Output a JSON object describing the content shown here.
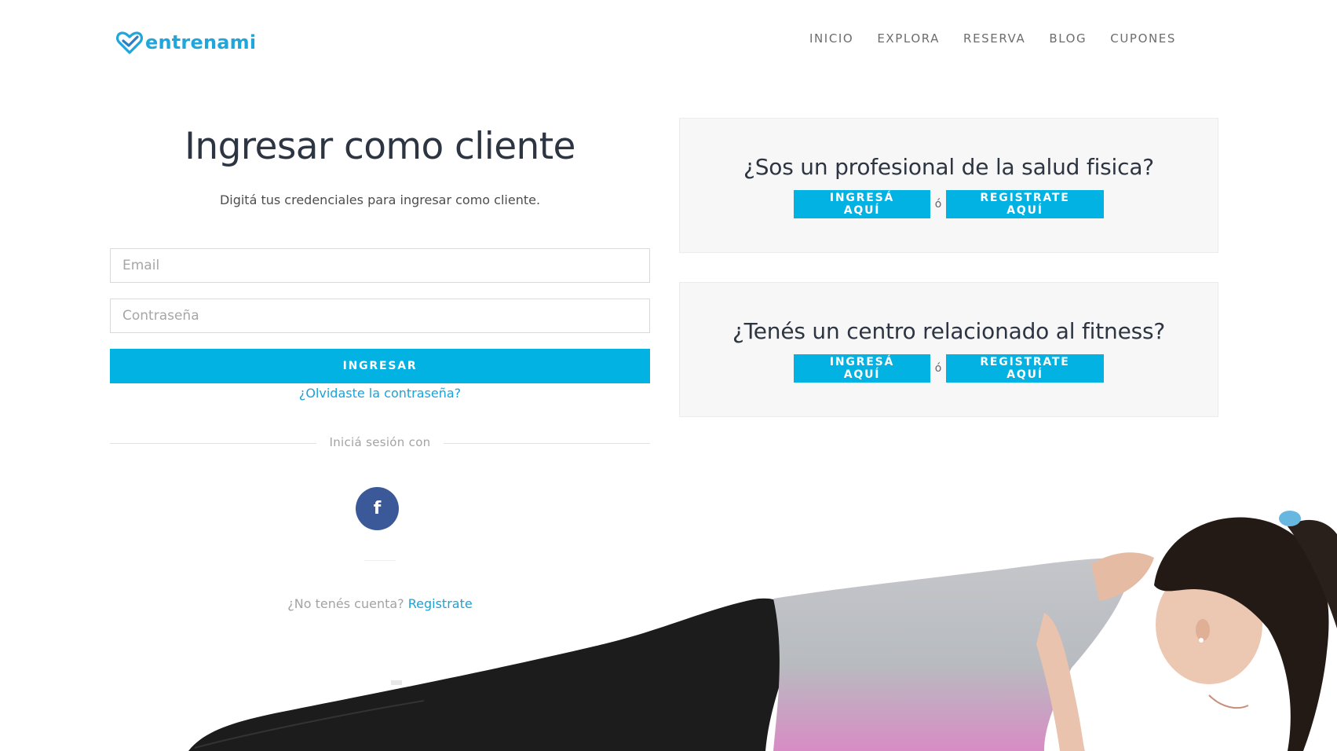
{
  "header": {
    "logo_text": "entrenami",
    "nav": [
      "INICIO",
      "EXPLORA",
      "RESERVA",
      "BLOG",
      "CUPONES"
    ]
  },
  "login": {
    "title": "Ingresar como cliente",
    "subtitle": "Digitá tus credenciales para ingresar como cliente.",
    "email_placeholder": "Email",
    "password_placeholder": "Contraseña",
    "submit_label": "INGRESAR",
    "forgot_label": "¿Olvidaste la contraseña?",
    "divider_label": "Iniciá sesión con",
    "facebook_icon": "f",
    "no_account_text": "¿No tenés cuenta?",
    "signup_link": "Registrate"
  },
  "boxes": [
    {
      "title": "¿Sos un profesional de la salud fisica?",
      "login_label": "INGRESÁ AQUÍ",
      "or_text": "ó",
      "register_label": "REGISTRATE AQUÍ"
    },
    {
      "title": "¿Tenés un centro relacionado al fitness?",
      "login_label": "INGRESÁ AQUÍ",
      "or_text": "ó",
      "register_label": "REGISTRATE AQUÍ"
    }
  ],
  "colors": {
    "accent": "#01b2e3",
    "link": "#1aa3d8",
    "logo": "#1fa6dd",
    "facebook": "#3b5998",
    "heading": "#2d3542"
  },
  "icons": {
    "logo": "heart-check-icon",
    "facebook": "facebook-icon"
  }
}
